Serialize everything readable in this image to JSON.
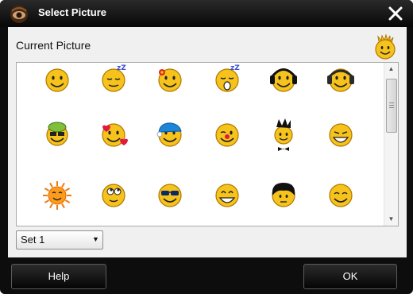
{
  "window": {
    "title": "Select Picture"
  },
  "current_picture_label": "Current Picture",
  "set_select": {
    "value": "Set 1"
  },
  "buttons": {
    "help": "Help",
    "ok": "OK"
  },
  "colors": {
    "titlebar": "#1a1a1a",
    "panel": "#f0f0f0",
    "smiley_yellow": "#f6c21c",
    "smiley_outline": "#b07800"
  },
  "pictures": [
    [
      "smile",
      "sleeping",
      "flower",
      "yawning",
      "headphones-black",
      "headphones-dark"
    ],
    [
      "green-hat",
      "hearts",
      "blue-cap",
      "wink-red-nose",
      "punk",
      "grin"
    ],
    [
      "sun",
      "eyes-up",
      "sunglasses",
      "big-grin",
      "black-hair",
      "content"
    ]
  ]
}
